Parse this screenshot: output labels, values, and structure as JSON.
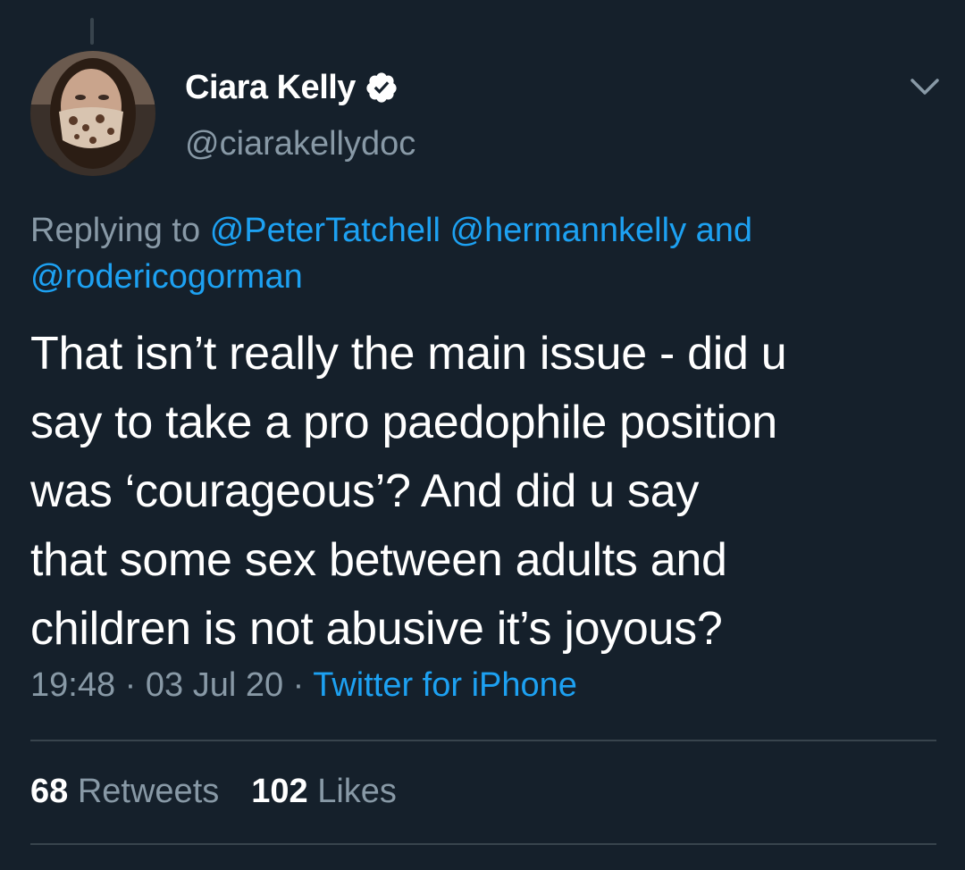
{
  "colors": {
    "background": "#15202b",
    "text_primary": "#ffffff",
    "text_secondary": "#8899a6",
    "link": "#1da1f2",
    "divider": "#38444d"
  },
  "tweet": {
    "author": {
      "display_name": "Ciara Kelly",
      "handle": "@ciarakellydoc",
      "verified": true,
      "verified_icon": "verified-badge-icon",
      "avatar_icon": "avatar"
    },
    "more_icon": "chevron-down-icon",
    "replying_to": {
      "prefix": "Replying to",
      "mentions": [
        "@PeterTatchell",
        "@hermannkelly"
      ],
      "conjunction": "and",
      "last_mention": "@rodericogorman"
    },
    "text_lines": [
      "That isn’t really the main issue - did u",
      "say to take a pro paedophile position",
      "was ‘courageous’? And did u say",
      "that some sex between adults and",
      "children is not abusive it’s joyous?"
    ],
    "meta": {
      "time": "19:48",
      "date": "03 Jul 20",
      "separator": "·",
      "source": "Twitter for iPhone"
    },
    "stats": {
      "retweets_count": "68",
      "retweets_label": "Retweets",
      "likes_count": "102",
      "likes_label": "Likes"
    }
  }
}
